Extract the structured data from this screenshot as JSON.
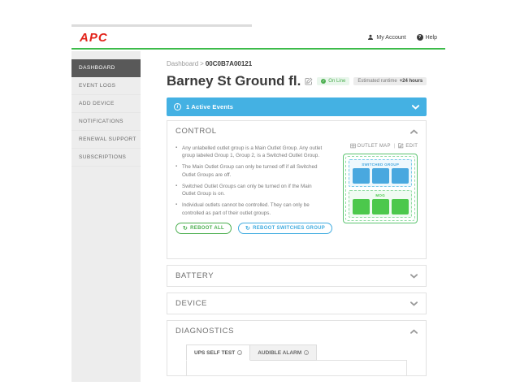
{
  "header": {
    "logo": "APC",
    "my_account_label": "My Account",
    "help_label": "Help",
    "help_glyph": "?"
  },
  "sidebar": {
    "items": [
      {
        "label": "DASHBOARD",
        "active": true
      },
      {
        "label": "EVENT LOGS",
        "active": false
      },
      {
        "label": "ADD DEVICE",
        "active": false
      },
      {
        "label": "NOTIFICATIONS",
        "active": false
      },
      {
        "label": "RENEWAL SUPPORT",
        "active": false
      },
      {
        "label": "SUBSCRIPTIONS",
        "active": false
      }
    ]
  },
  "breadcrumb": {
    "parent": "Dashboard",
    "separator": ">",
    "current": "00C0B7A00121"
  },
  "device": {
    "name": "Barney St Ground fl.",
    "status_label": "On Line",
    "runtime_prefix": "Estimated runtime",
    "runtime_value": "+24 hours"
  },
  "alerts": {
    "active_events_label": "1 Active Events",
    "info_glyph": "i"
  },
  "control": {
    "title": "CONTROL",
    "outlet_map_link": "OUTLET MAP",
    "edit_link": "EDIT",
    "link_divider": "|",
    "notes": [
      "Any unlabelled outlet group is a Main Outlet Group. Any outlet group labeled Group 1, Group 2, is a Switched Outlet Group.",
      "The Main Outlet Group can only be turned off if all Switched Outlet Groups are off.",
      "Switched Outlet Groups can only be turned on if the Main Outlet Group is on.",
      "Individual outlets cannot be controlled. They can only be controlled as part of their outlet groups."
    ],
    "buttons": [
      {
        "label": "REBOOT ALL"
      },
      {
        "label": "REBOOT SWITCHES GROUP"
      }
    ],
    "refresh_glyph": "↻",
    "outlet_map": {
      "groups": [
        {
          "label": "SWITCHED GROUP",
          "color": "blue",
          "outlets": 3
        },
        {
          "label": "MOG",
          "color": "green",
          "outlets": 3
        }
      ]
    }
  },
  "sections": {
    "battery": "BATTERY",
    "device": "DEVICE",
    "diagnostics": "DIAGNOSTICS"
  },
  "diagnostics": {
    "tabs": [
      {
        "label": "UPS SELF TEST",
        "active": true
      },
      {
        "label": "AUDIBLE ALARM",
        "active": false
      }
    ],
    "info_glyph": "i"
  },
  "colors": {
    "accent_green": "#3dbb4a",
    "logo_red": "#e2231a",
    "events_blue": "#44b1e3",
    "status_green": "#4caf50",
    "outlet_blue": "#49a8df",
    "outlet_green": "#4cc84c",
    "sidebar_active": "#595959"
  }
}
